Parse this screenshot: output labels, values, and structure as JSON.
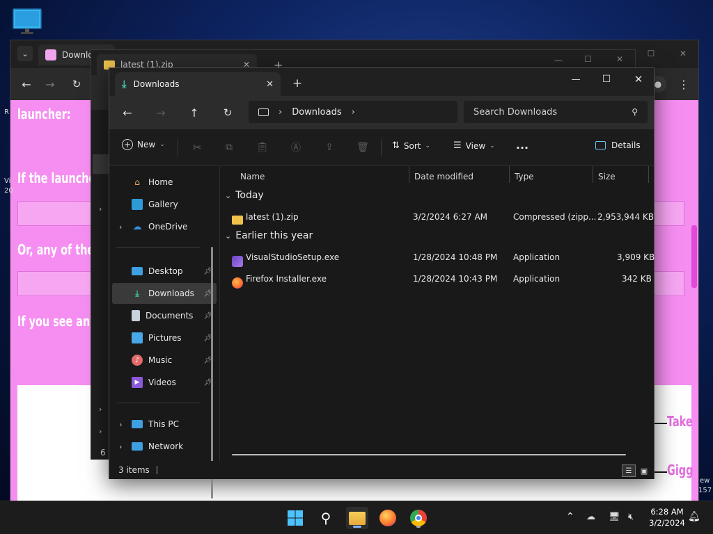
{
  "browser_back": {
    "tab_label": "Downlo",
    "page_text": {
      "launcher": "launcher:",
      "if_launcher": "If the launcher",
      "or_any": "Or, any of the l",
      "if_you_see": "If you see anyt",
      "side_left_1": "R",
      "side_left_2": "Vi",
      "side_left_3": "20",
      "side_right_1": "ew",
      "side_right_2": "157",
      "take": "Take",
      "gigg": "Gigg",
      "count_6": "6 i"
    }
  },
  "browser_mid": {
    "tab_label": "latest (1).zip"
  },
  "explorer": {
    "tab_title": "Downloads",
    "breadcrumb": "Downloads",
    "search_placeholder": "Search Downloads",
    "commands": {
      "new": "New",
      "sort": "Sort",
      "view": "View",
      "details": "Details"
    },
    "nav": {
      "home": "Home",
      "gallery": "Gallery",
      "onedrive": "OneDrive",
      "desktop": "Desktop",
      "downloads": "Downloads",
      "documents": "Documents",
      "pictures": "Pictures",
      "music": "Music",
      "videos": "Videos",
      "this_pc": "This PC",
      "network": "Network"
    },
    "columns": {
      "name": "Name",
      "date": "Date modified",
      "type": "Type",
      "size": "Size"
    },
    "groups": {
      "today": "Today",
      "earlier": "Earlier this year"
    },
    "files": [
      {
        "name": "latest (1).zip",
        "date": "3/2/2024 6:27 AM",
        "type": "Compressed (zipp...",
        "size": "2,953,944 KB"
      },
      {
        "name": "VisualStudioSetup.exe",
        "date": "1/28/2024 10:48 PM",
        "type": "Application",
        "size": "3,909 KB"
      },
      {
        "name": "Firefox Installer.exe",
        "date": "1/28/2024 10:43 PM",
        "type": "Application",
        "size": "342 KB"
      }
    ],
    "status": "3 items"
  },
  "taskbar": {
    "time": "6:28 AM",
    "date": "3/2/2024"
  },
  "colors": {
    "accent": "#4cc2ff",
    "page_pink": "#f58ef0",
    "explorer_bg": "#191919"
  }
}
